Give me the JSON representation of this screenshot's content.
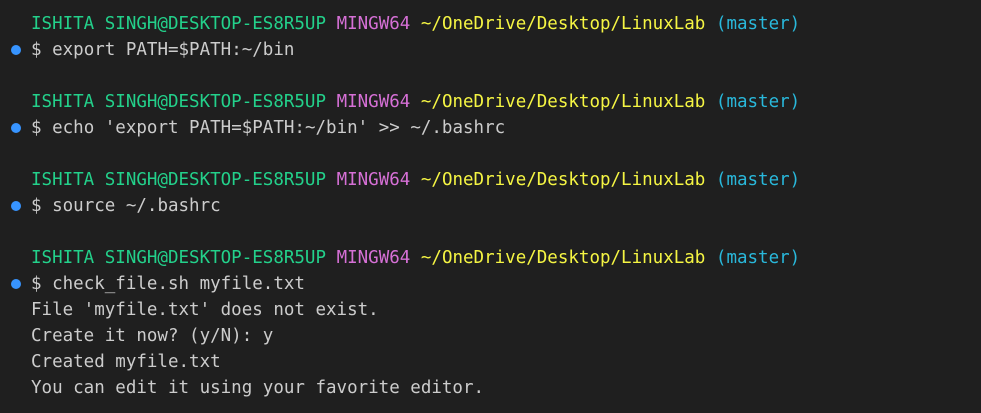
{
  "prompt": {
    "user_host": "ISHITA SINGH@DESKTOP-ES8R5UP",
    "system": "MINGW64",
    "path": "~/OneDrive/Desktop/LinuxLab",
    "branch": "(master)",
    "symbol": "$"
  },
  "commands": [
    {
      "text": "export PATH=$PATH:~/bin"
    },
    {
      "text": "echo 'export PATH=$PATH:~/bin' >> ~/.bashrc"
    },
    {
      "text": "source ~/.bashrc"
    },
    {
      "text": "check_file.sh myfile.txt"
    }
  ],
  "output": [
    "File 'myfile.txt' does not exist.",
    "Create it now? (y/N): y",
    "Created myfile.txt",
    "You can edit it using your favorite editor."
  ],
  "colors": {
    "background": "#1f1f1f",
    "user_host": "#23d18b",
    "system": "#d670d6",
    "path": "#f5f543",
    "branch": "#29b8db",
    "decoration_dot": "#3794ff"
  }
}
